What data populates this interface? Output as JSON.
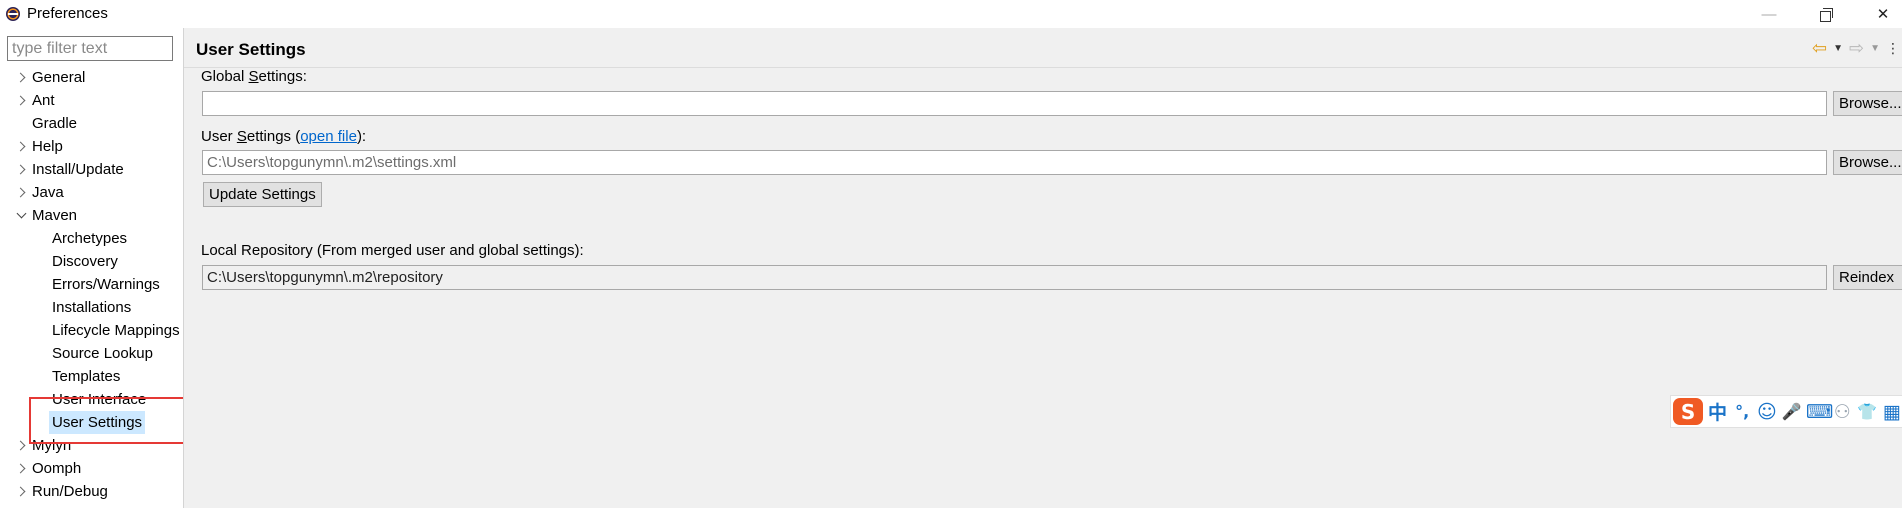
{
  "window": {
    "title": "Preferences",
    "minimize_glyph": "—",
    "close_glyph": "✕"
  },
  "sidebar": {
    "filter_placeholder": "type filter text",
    "tree": [
      {
        "label": "General",
        "level": 0,
        "expandable": true,
        "expanded": false
      },
      {
        "label": "Ant",
        "level": 0,
        "expandable": true,
        "expanded": false
      },
      {
        "label": "Gradle",
        "level": 0,
        "expandable": false,
        "expanded": false
      },
      {
        "label": "Help",
        "level": 0,
        "expandable": true,
        "expanded": false
      },
      {
        "label": "Install/Update",
        "level": 0,
        "expandable": true,
        "expanded": false
      },
      {
        "label": "Java",
        "level": 0,
        "expandable": true,
        "expanded": false
      },
      {
        "label": "Maven",
        "level": 0,
        "expandable": true,
        "expanded": true
      },
      {
        "label": "Archetypes",
        "level": 1
      },
      {
        "label": "Discovery",
        "level": 1
      },
      {
        "label": "Errors/Warnings",
        "level": 1
      },
      {
        "label": "Installations",
        "level": 1
      },
      {
        "label": "Lifecycle Mappings",
        "level": 1
      },
      {
        "label": "Source Lookup",
        "level": 1
      },
      {
        "label": "Templates",
        "level": 1
      },
      {
        "label": "User Interface",
        "level": 1
      },
      {
        "label": "User Settings",
        "level": 1,
        "selected": true
      },
      {
        "label": "Mylyn",
        "level": 0,
        "expandable": true,
        "expanded": false
      },
      {
        "label": "Oomph",
        "level": 0,
        "expandable": true,
        "expanded": false
      },
      {
        "label": "Run/Debug",
        "level": 0,
        "expandable": true,
        "expanded": false
      }
    ]
  },
  "page": {
    "title": "User Settings",
    "nav": {
      "back_icon": "⇦",
      "forward_icon": "⇨",
      "dropdown_glyph": "▼",
      "menu_glyph": "⋮"
    },
    "global_settings": {
      "label_prefix": "Global ",
      "label_mnemonic": "S",
      "label_suffix": "ettings:",
      "value": "",
      "browse_label": "Browse..."
    },
    "user_settings": {
      "label_prefix": "User ",
      "label_mnemonic": "S",
      "label_suffix": "ettings (",
      "link_text": "open file",
      "label_end": "):",
      "value": "C:\\Users\\topgunymn\\.m2\\settings.xml",
      "browse_label": "Browse..."
    },
    "update_button": "Update Settings",
    "local_repository": {
      "label": "Local Repository (From merged user and global settings):",
      "value": "C:\\Users\\topgunymn\\.m2\\repository",
      "reindex_label": "Reindex"
    }
  },
  "ime_toolbar": {
    "logo": "S",
    "items": [
      "中",
      "°,",
      "☺",
      "🎤",
      "⌨",
      "⚇",
      "👕",
      "▦"
    ]
  },
  "colors": {
    "selection": "#cce8ff",
    "annotation_border": "#e53935",
    "link": "#0066cc",
    "ime_accent": "#f05a24"
  }
}
